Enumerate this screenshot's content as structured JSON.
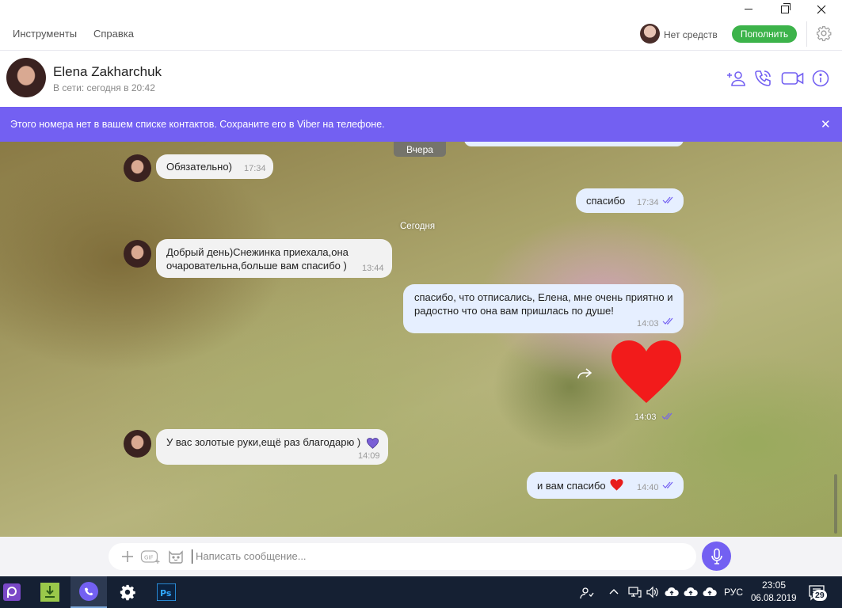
{
  "menu": {
    "tools": "Инструменты",
    "help": "Справка",
    "balance": "Нет средств",
    "topup": "Пополнить"
  },
  "contact": {
    "name": "Elena Zakharchuk",
    "status": "В сети: сегодня в 20:42"
  },
  "banner": {
    "text": "Этого номера нет в вашем списке контактов. Сохраните его в Viber на телефоне."
  },
  "chat": {
    "date_yesterday": "Вчера",
    "date_today": "Сегодня",
    "messages": [
      {
        "dir": "in",
        "text": "Обязательно)",
        "time": "17:34"
      },
      {
        "dir": "out",
        "text": "спасибо",
        "time": "17:34"
      },
      {
        "dir": "in",
        "text": "Добрый день)Снежинка приехала,она очаровательна,больше вам спасибо )",
        "time": "13:44"
      },
      {
        "dir": "out",
        "text": "спасибо, что отписались, Елена, мне очень приятно и радостно что она вам пришлась по душе!",
        "time": "14:03"
      },
      {
        "dir": "out",
        "sticker": "red-heart",
        "time": "14:03"
      },
      {
        "dir": "in",
        "text": "У вас золотые руки,ещё раз благодарю )",
        "time": "14:09",
        "emoji": "purple-heart"
      },
      {
        "dir": "out",
        "text": "и вам спасибо",
        "time": "14:40",
        "emoji": "red-heart"
      }
    ]
  },
  "composer": {
    "placeholder": "Написать сообщение..."
  },
  "taskbar": {
    "lang": "РУС",
    "time": "23:05",
    "date": "06.08.2019",
    "notifications": "29"
  },
  "colors": {
    "accent": "#7360f2",
    "topup": "#3cb34a",
    "incoming_bubble": "#f2f2f2",
    "outgoing_bubble": "#e6efff",
    "taskbar": "#152033"
  }
}
